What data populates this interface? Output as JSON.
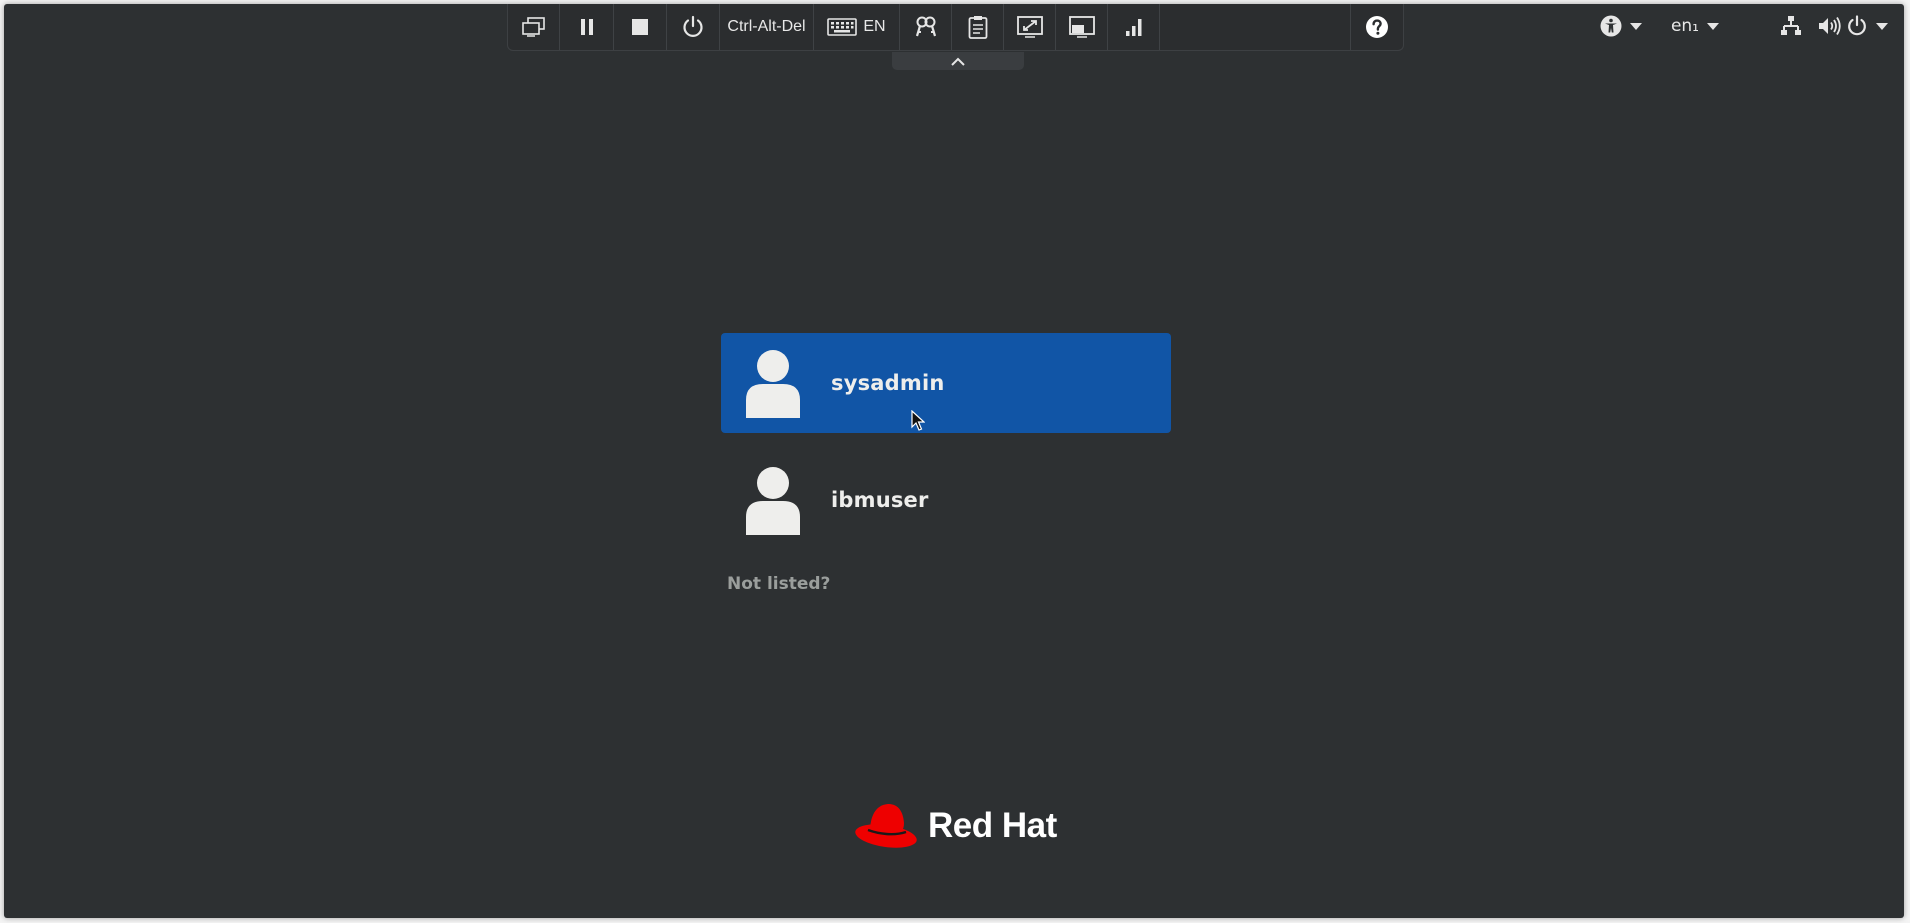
{
  "toolbar": {
    "ctrl_alt_del_label": "Ctrl-Alt-Del",
    "keyboard_language": "EN",
    "buttons": [
      "screens-icon",
      "pause-icon",
      "stop-icon",
      "power-icon",
      "ctrl-alt-del",
      "keyboard-en",
      "keys-icon",
      "clipboard-icon",
      "scale-icon",
      "resize-icon",
      "signal-icon",
      "help-icon"
    ]
  },
  "top_bar": {
    "input_source": "en₁",
    "indicators": [
      "accessibility-icon",
      "input-source",
      "network-icon",
      "volume-icon",
      "power-menu-icon"
    ]
  },
  "users": [
    {
      "name": "sysadmin",
      "selected": true
    },
    {
      "name": "ibmuser",
      "selected": false
    }
  ],
  "not_listed_label": "Not listed?",
  "logo": {
    "text": "Red Hat"
  },
  "colors": {
    "background": "#2d3032",
    "selected_user": "#1155a6",
    "logo_red": "#ee0000"
  }
}
